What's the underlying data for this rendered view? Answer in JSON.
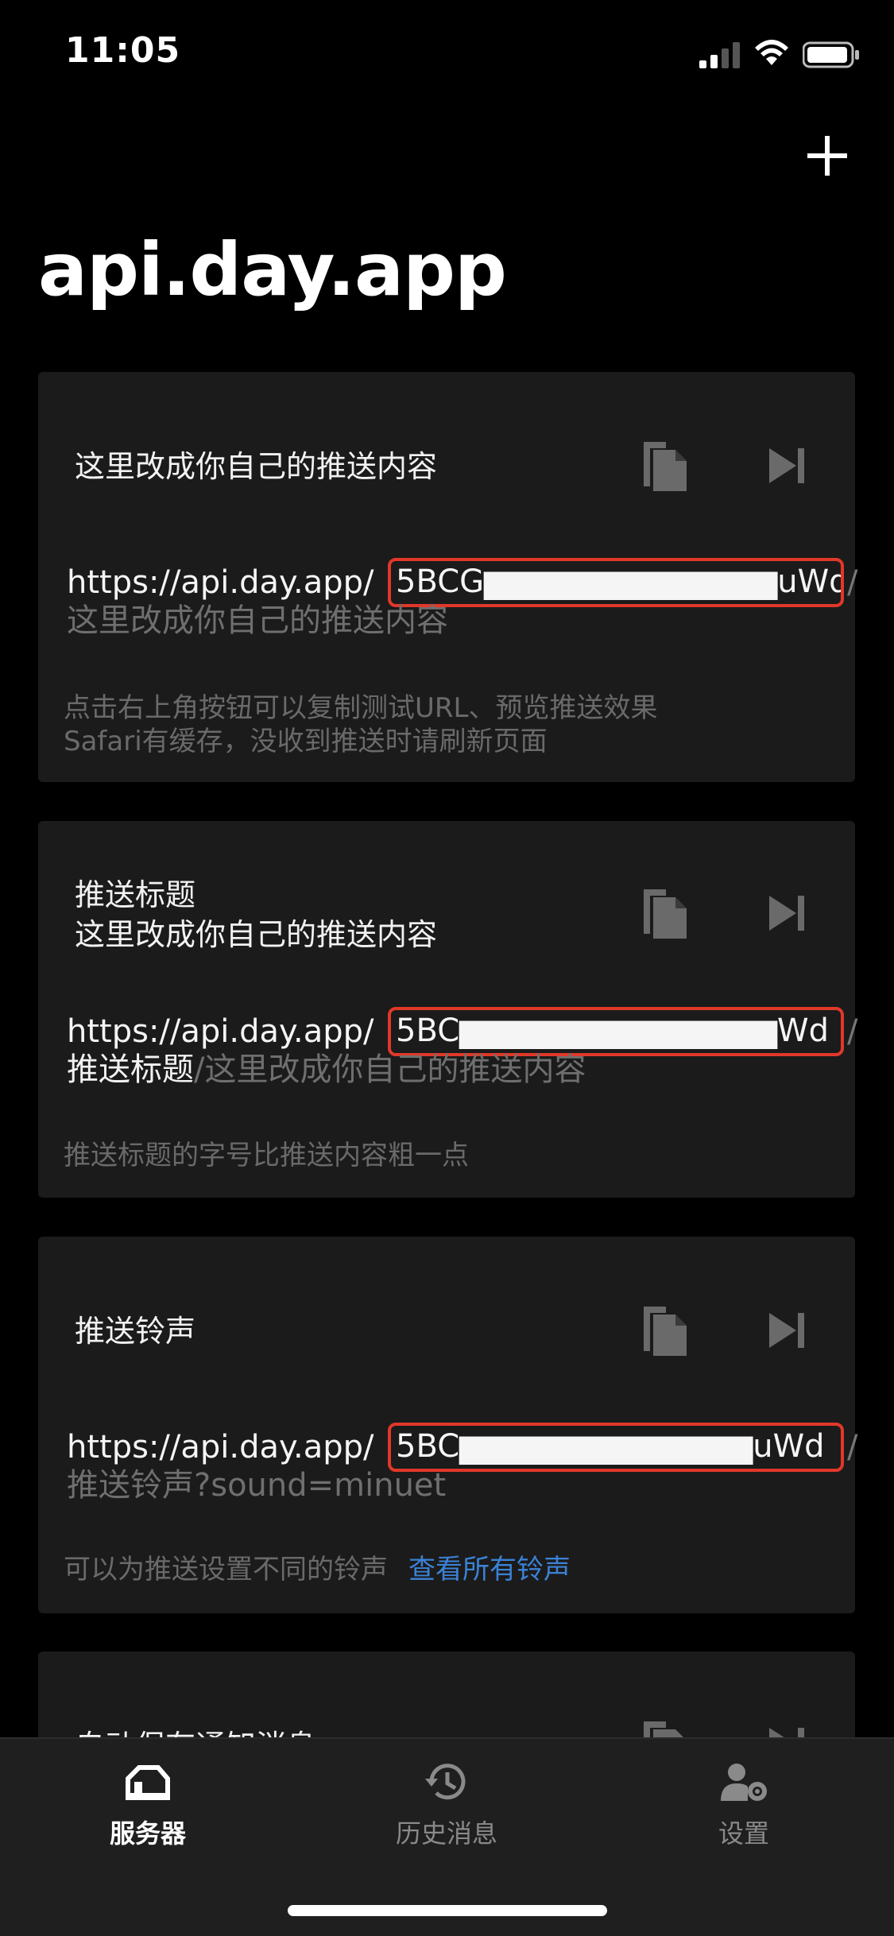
{
  "status_bar": {
    "time": "11:05"
  },
  "page": {
    "title": "api.day.app"
  },
  "cards": [
    {
      "title_line1": "这里改成你自己的推送内容",
      "url_prefix": "https://api.day.app/",
      "url_key": "5BCG▆▆▆▆▆▆▆▆▆▆▆▆uWd",
      "url_slash": "/",
      "url_suffix_title": "",
      "url_suffix_sep": "",
      "url_suffix": "这里改成你自己的推送内容",
      "desc_line1": "点击右上角按钮可以复制测试URL、预览推送效果",
      "desc_line2": "Safari有缓存，没收到推送时请刷新页面"
    },
    {
      "title_line1": "推送标题",
      "title_line2": "这里改成你自己的推送内容",
      "url_prefix": "https://api.day.app/",
      "url_key": "5BC▆▆▆▆▆▆▆▆▆▆▆▆▆Wd",
      "url_slash": "/",
      "url_suffix_title": "推送标题",
      "url_suffix_sep": "/",
      "url_suffix": "这里改成你自己的推送内容",
      "desc_line1": "推送标题的字号比推送内容粗一点"
    },
    {
      "title_line1": "推送铃声",
      "url_prefix": "https://api.day.app/",
      "url_key": "5BC▆▆▆▆▆▆▆▆▆▆▆▆uWd",
      "url_slash": "/",
      "url_suffix": "推送铃声?sound=minuet",
      "desc_line1": "可以为推送设置不同的铃声",
      "desc_link": "查看所有铃声"
    },
    {
      "title_line1": "自动保存通知消息"
    }
  ],
  "tab_bar": {
    "tabs": [
      {
        "label": "服务器",
        "icon": "server-icon",
        "active": true
      },
      {
        "label": "历史消息",
        "icon": "history-icon",
        "active": false
      },
      {
        "label": "设置",
        "icon": "settings-user-icon",
        "active": false
      }
    ]
  },
  "colors": {
    "background": "#000000",
    "card": "#1b1b1b",
    "highlight_box": "#e1382a",
    "link": "#3b82d6"
  }
}
